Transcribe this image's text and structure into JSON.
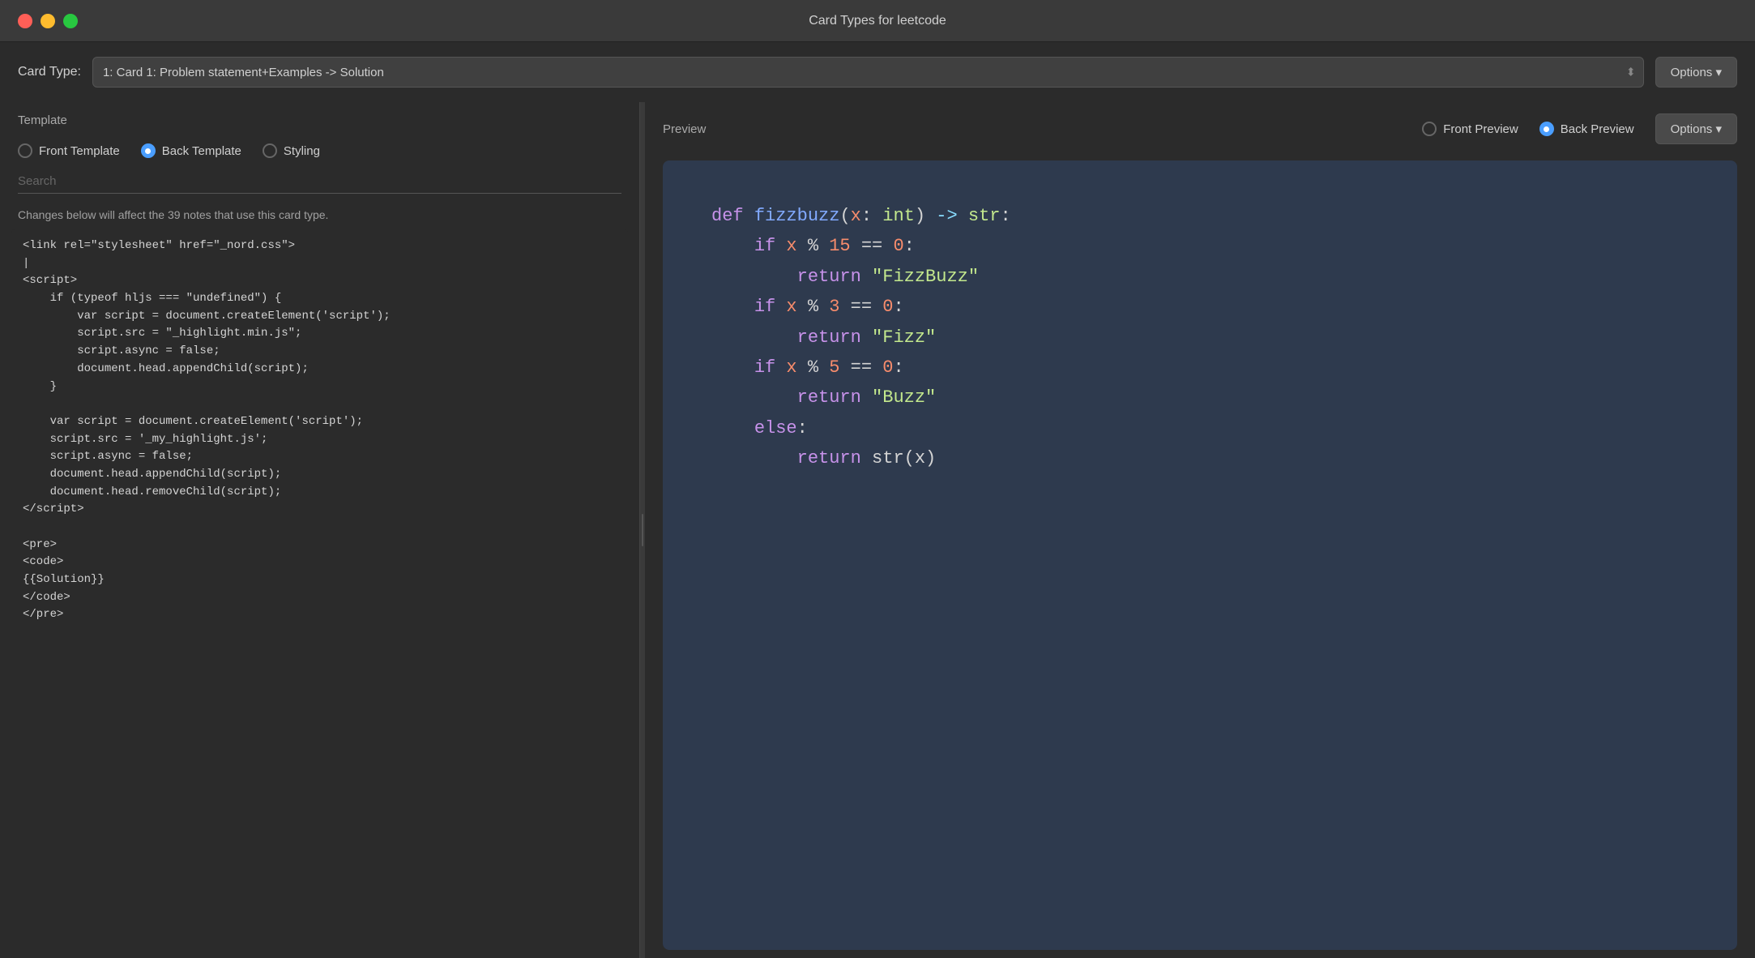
{
  "titleBar": {
    "title": "Card Types for leetcode"
  },
  "cardTypeBar": {
    "label": "Card Type:",
    "selectValue": "1: Card 1: Problem statement+Examples -> Solution",
    "optionsLabel": "Options ▾"
  },
  "leftPanel": {
    "title": "Template",
    "radioOptions": [
      {
        "id": "front-template",
        "label": "Front Template",
        "selected": false
      },
      {
        "id": "back-template",
        "label": "Back Template",
        "selected": true
      },
      {
        "id": "styling",
        "label": "Styling",
        "selected": false
      }
    ],
    "searchPlaceholder": "Search",
    "warningText": "Changes below will affect the 39 notes that use this card type.",
    "codeContent": "<link rel=\"stylesheet\" href=\"_nord.css\">\n|\n<script>\n    if (typeof hljs === \"undefined\") {\n        var script = document.createElement('script');\n        script.src = \"_highlight.min.js\";\n        script.async = false;\n        document.head.appendChild(script);\n    }\n\n    var script = document.createElement('script');\n    script.src = '_my_highlight.js';\n    script.async = false;\n    document.head.appendChild(script);\n    document.head.removeChild(script);\n<\\/script>\n\n<pre>\n<code>\n{{Solution}}\n</code>\n</pre>"
  },
  "rightPanel": {
    "title": "Preview",
    "radioOptions": [
      {
        "id": "front-preview",
        "label": "Front Preview",
        "selected": false
      },
      {
        "id": "back-preview",
        "label": "Back Preview",
        "selected": true
      }
    ],
    "optionsLabel": "Options ▾"
  }
}
